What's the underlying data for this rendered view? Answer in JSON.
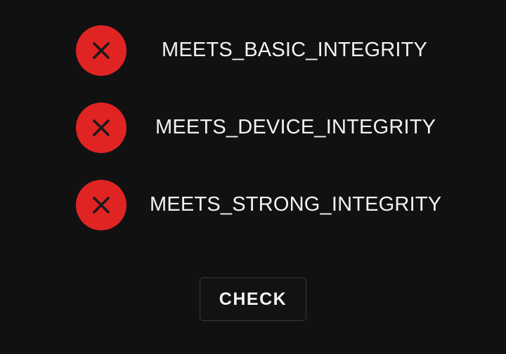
{
  "checks": [
    {
      "label": "MEETS_BASIC_INTEGRITY",
      "status": "fail",
      "icon": "x-circle-icon"
    },
    {
      "label": "MEETS_DEVICE_INTEGRITY",
      "status": "fail",
      "icon": "x-circle-icon"
    },
    {
      "label": "MEETS_STRONG_INTEGRITY",
      "status": "fail",
      "icon": "x-circle-icon"
    }
  ],
  "button": {
    "label": "CHECK"
  },
  "colors": {
    "background": "#111112",
    "fail": "#e02424",
    "text": "#f2f2f2",
    "button_border": "#3a3a3c"
  }
}
